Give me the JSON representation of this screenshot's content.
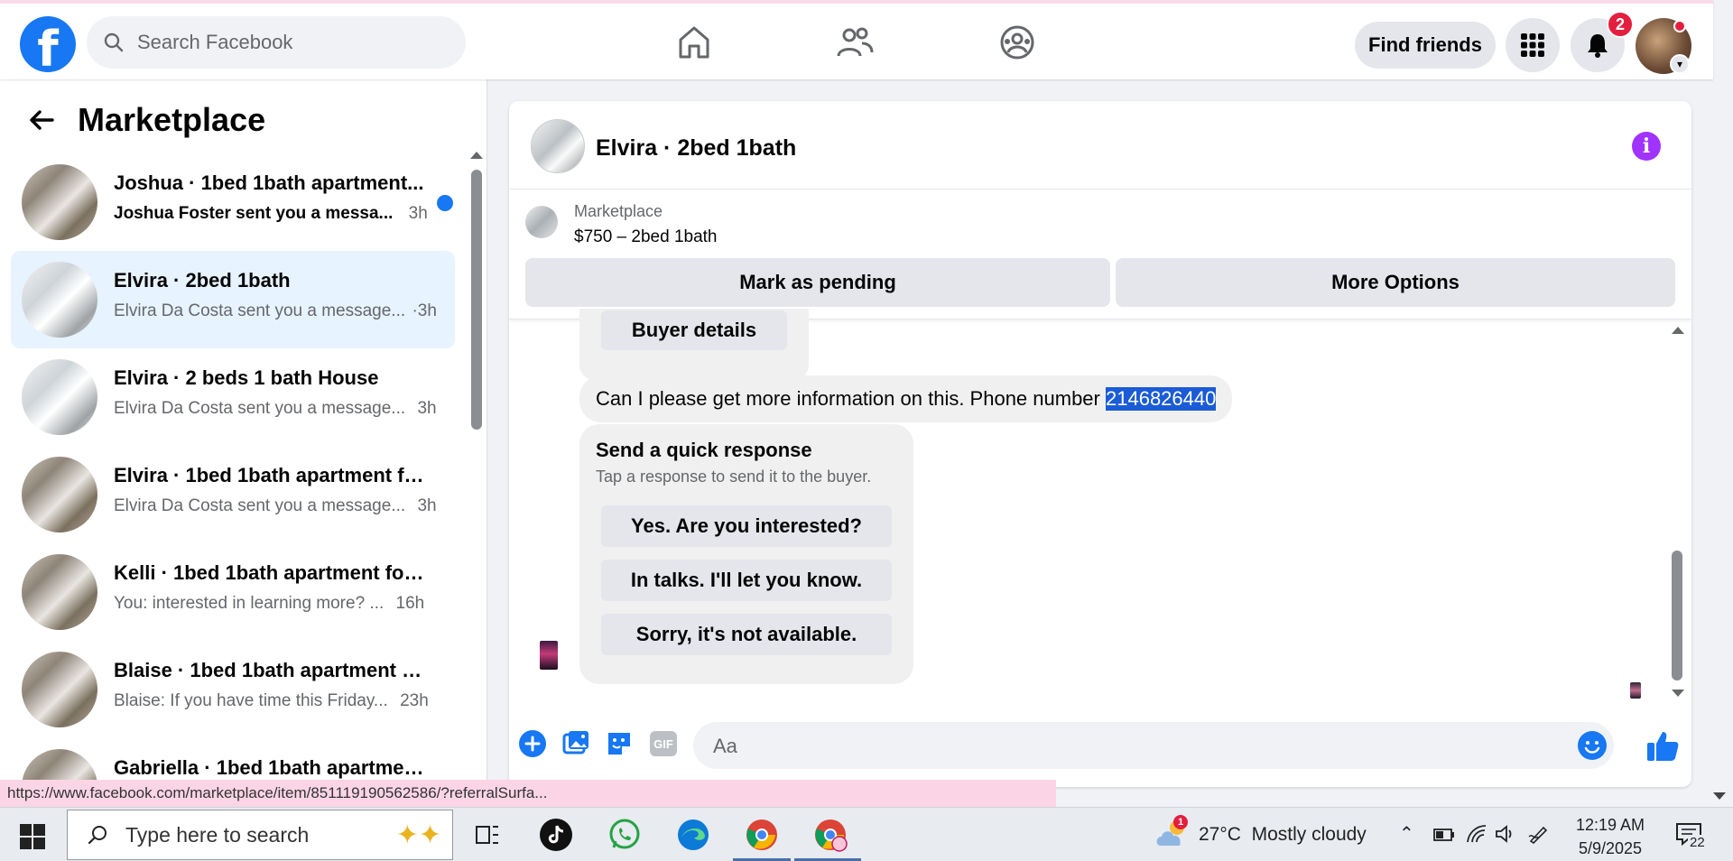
{
  "topbar": {
    "logo_letter": "f",
    "search_placeholder": "Search Facebook",
    "find_friends": "Find friends",
    "notification_count": "2"
  },
  "sidebar": {
    "title": "Marketplace",
    "conversations": [
      {
        "title": "Joshua · 1bed 1bath apartment...",
        "preview": "Joshua Foster sent you a messa...",
        "time": "3h",
        "unread": true
      },
      {
        "title": "Elvira · 2bed 1bath",
        "preview": "Elvira Da Costa sent you a message...",
        "time": "·3h",
        "unread": false,
        "active": true
      },
      {
        "title": "Elvira · 2 beds 1 bath House",
        "preview": "Elvira Da Costa sent you a message...",
        "time": "3h",
        "unread": false
      },
      {
        "title": "Elvira · 1bed 1bath apartment fo...",
        "preview": "Elvira Da Costa sent you a message...",
        "time": "3h",
        "unread": false
      },
      {
        "title": "Kelli · 1bed 1bath apartment for ...",
        "preview": "You: interested in learning more? ...",
        "time": "16h",
        "unread": false
      },
      {
        "title": "Blaise · 1bed 1bath apartment fo...",
        "preview": "Blaise: If you have time this Friday...",
        "time": "23h",
        "unread": false
      },
      {
        "title": "Gabriella · 1bed 1bath apartmen...",
        "preview": "",
        "time": "",
        "unread": false
      }
    ]
  },
  "chat": {
    "title": "Elvira · 2bed 1bath",
    "listing_source": "Marketplace",
    "listing_price": "$750 – 2bed 1bath",
    "mark_pending": "Mark as pending",
    "more_options": "More Options",
    "buyer_details": "Buyer details",
    "message_text": "Can I please get more information on this. Phone number ",
    "message_highlight": "2146826440",
    "quick_title": "Send a quick response",
    "quick_subtitle": "Tap a response to send it to the buyer.",
    "quick_options": [
      "Yes. Are you interested?",
      "In talks. I'll let you know.",
      "Sorry, it's not available."
    ],
    "composer_placeholder": "Aa",
    "gif_label": "GIF"
  },
  "status_url": "https://www.facebook.com/marketplace/item/851119190562586/?referralSurfa...",
  "taskbar": {
    "search_placeholder": "Type here to search",
    "weather_badge": "1",
    "temperature": "27°C",
    "weather_desc": "Mostly cloudy",
    "time": "12:19 AM",
    "date": "5/9/2025",
    "notification_count": "22"
  },
  "colors": {
    "brand_blue": "#1877f2",
    "active_conv": "#e7f3ff",
    "info_purple": "#a033ff",
    "badge_red": "#e41e3f",
    "highlight": "#1a5bd6"
  }
}
